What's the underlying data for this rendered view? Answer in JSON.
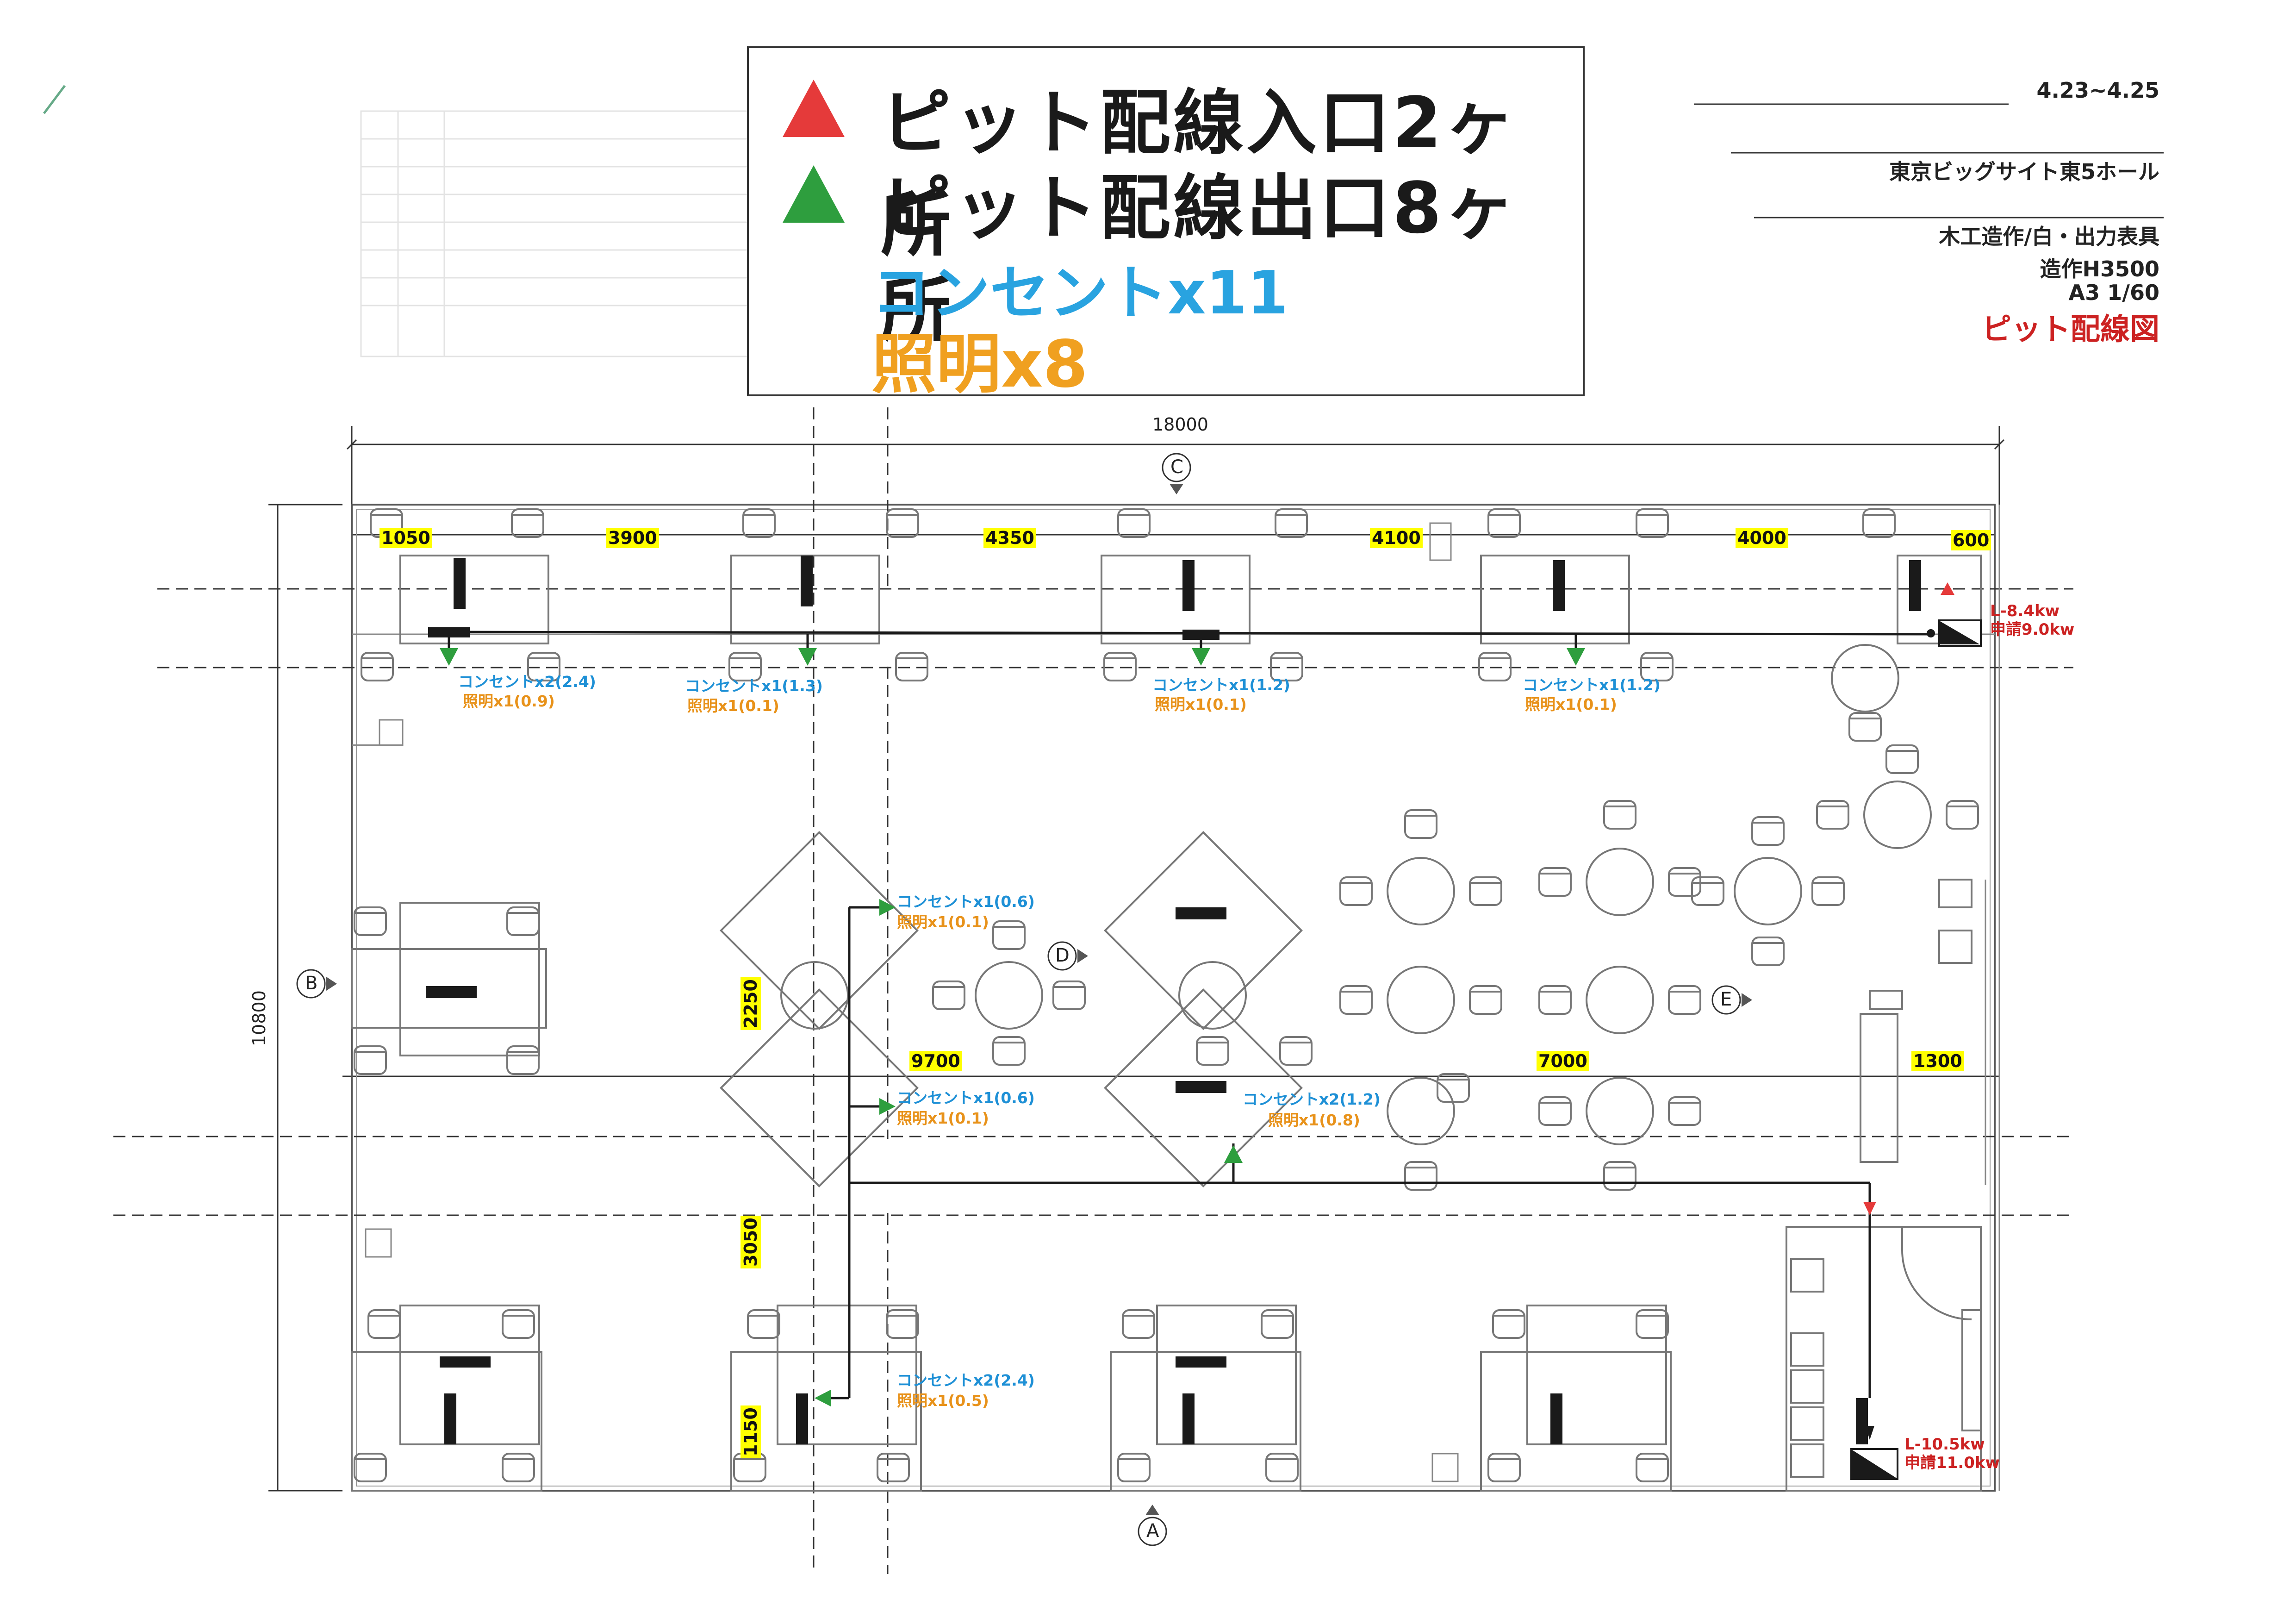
{
  "legend": {
    "inlet_label": "ピット配線入口2ヶ所",
    "outlet_label": "ピット配線出口8ヶ所",
    "outlet_total": "コンセントx11",
    "lighting_total": "照明x8",
    "inlet_color": "#e53a3a",
    "outlet_color": "#2e9e3e"
  },
  "title_block": {
    "date": "4.23~4.25",
    "venue": "東京ビッグサイト東5ホール",
    "spec": "木工造作/白・出力表具",
    "height": "造作H3500",
    "scale": "A3 1/60",
    "drawing_title": "ピット配線図"
  },
  "dimensions": {
    "overall_width": "18000",
    "overall_depth": "10800",
    "top": [
      "1050",
      "3900",
      "4350",
      "4100",
      "4000",
      "600"
    ],
    "middle": [
      "9700",
      "7000",
      "1300"
    ],
    "vertical": [
      "2250",
      "3050",
      "1150"
    ]
  },
  "grid_markers": [
    "A",
    "B",
    "C",
    "D",
    "E"
  ],
  "panels": [
    {
      "power": "L-8.4kw",
      "request": "申請9.0kw"
    },
    {
      "power": "L-10.5kw",
      "request": "申請11.0kw"
    }
  ],
  "outlets": [
    {
      "outlet": "コンセントx2(2.4)",
      "light": "照明x1(0.9)"
    },
    {
      "outlet": "コンセントx1(1.3)",
      "light": "照明x1(0.1)"
    },
    {
      "outlet": "コンセントx1(1.2)",
      "light": "照明x1(0.1)"
    },
    {
      "outlet": "コンセントx1(1.2)",
      "light": "照明x1(0.1)"
    },
    {
      "outlet": "コンセントx1(0.6)",
      "light": "照明x1(0.1)"
    },
    {
      "outlet": "コンセントx1(0.6)",
      "light": "照明x1(0.1)"
    },
    {
      "outlet": "コンセントx2(1.2)",
      "light": "照明x1(0.8)"
    },
    {
      "outlet": "コンセントx2(2.4)",
      "light": "照明x1(0.5)"
    }
  ]
}
